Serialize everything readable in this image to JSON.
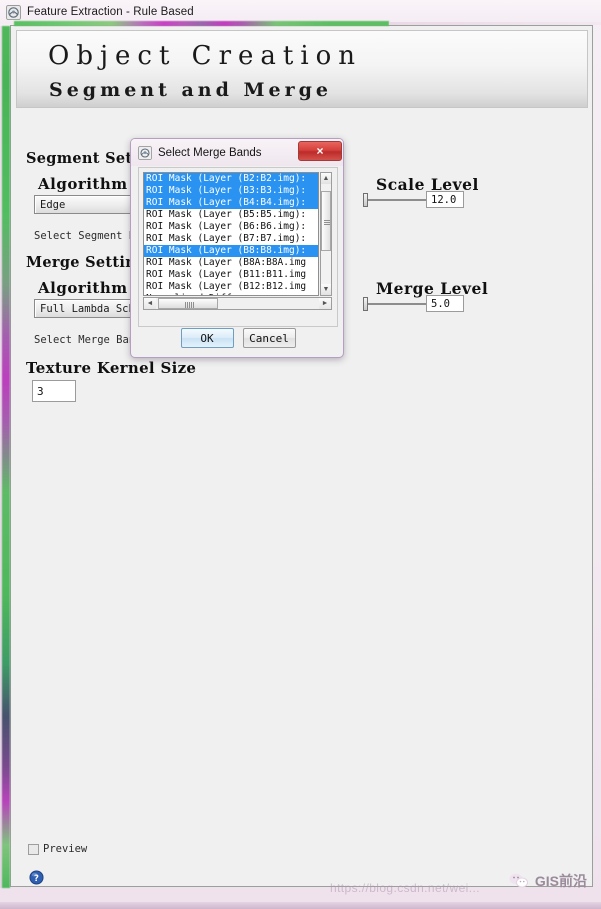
{
  "window": {
    "title": "Feature Extraction - Rule Based",
    "icon": "app-icon"
  },
  "banner": {
    "line1": "Object Creation",
    "line2": "Segment and Merge"
  },
  "segment_settings": {
    "group_label": "Segment Settings",
    "algorithm_label": "Algorithm",
    "algorithm_value": "Edge",
    "select_bands_label": "Select Segment Bands",
    "scale_level_label": "Scale Level",
    "scale_level_value": "12.0"
  },
  "merge_settings": {
    "group_label": "Merge Settings",
    "algorithm_label": "Algorithm",
    "algorithm_value": "Full Lambda Schedule",
    "select_bands_label": "Select Merge Bands",
    "merge_level_label": "Merge Level",
    "merge_level_value": "5.0"
  },
  "texture": {
    "label": "Texture Kernel Size",
    "value": "3"
  },
  "footer": {
    "preview_label": "Preview",
    "help_icon": "help-icon"
  },
  "dialog": {
    "title": "Select Merge Bands",
    "icon": "dialog-icon",
    "close_label": "×",
    "ok_label": "OK",
    "cancel_label": "Cancel",
    "items": [
      {
        "label": "ROI Mask (Layer (B2:B2.img):",
        "selected": true
      },
      {
        "label": "ROI Mask (Layer (B3:B3.img):",
        "selected": true
      },
      {
        "label": "ROI Mask (Layer (B4:B4.img):",
        "selected": true
      },
      {
        "label": "ROI Mask (Layer (B5:B5.img):",
        "selected": false
      },
      {
        "label": "ROI Mask (Layer (B6:B6.img):",
        "selected": false
      },
      {
        "label": "ROI Mask (Layer (B7:B7.img):",
        "selected": false
      },
      {
        "label": "ROI Mask (Layer (B8:B8.img):",
        "selected": true
      },
      {
        "label": "ROI Mask (Layer (B8A:B8A.img",
        "selected": false
      },
      {
        "label": "ROI Mask (Layer (B11:B11.img",
        "selected": false
      },
      {
        "label": "ROI Mask (Layer (B12:B12.img",
        "selected": false
      },
      {
        "label": "Normalized Difference",
        "selected": false
      }
    ],
    "scroll_up": "▲",
    "scroll_down": "▼",
    "scroll_left": "◄",
    "scroll_right": "►"
  },
  "watermark": {
    "url": "https://blog.csdn.net/wei...",
    "brand": "GIS前沿"
  },
  "colors": {
    "selection_blue": "#2a92f0",
    "close_red": "#d6413c",
    "stripe_green": "#4fb85c",
    "stripe_magenta": "#bb3fbe"
  }
}
